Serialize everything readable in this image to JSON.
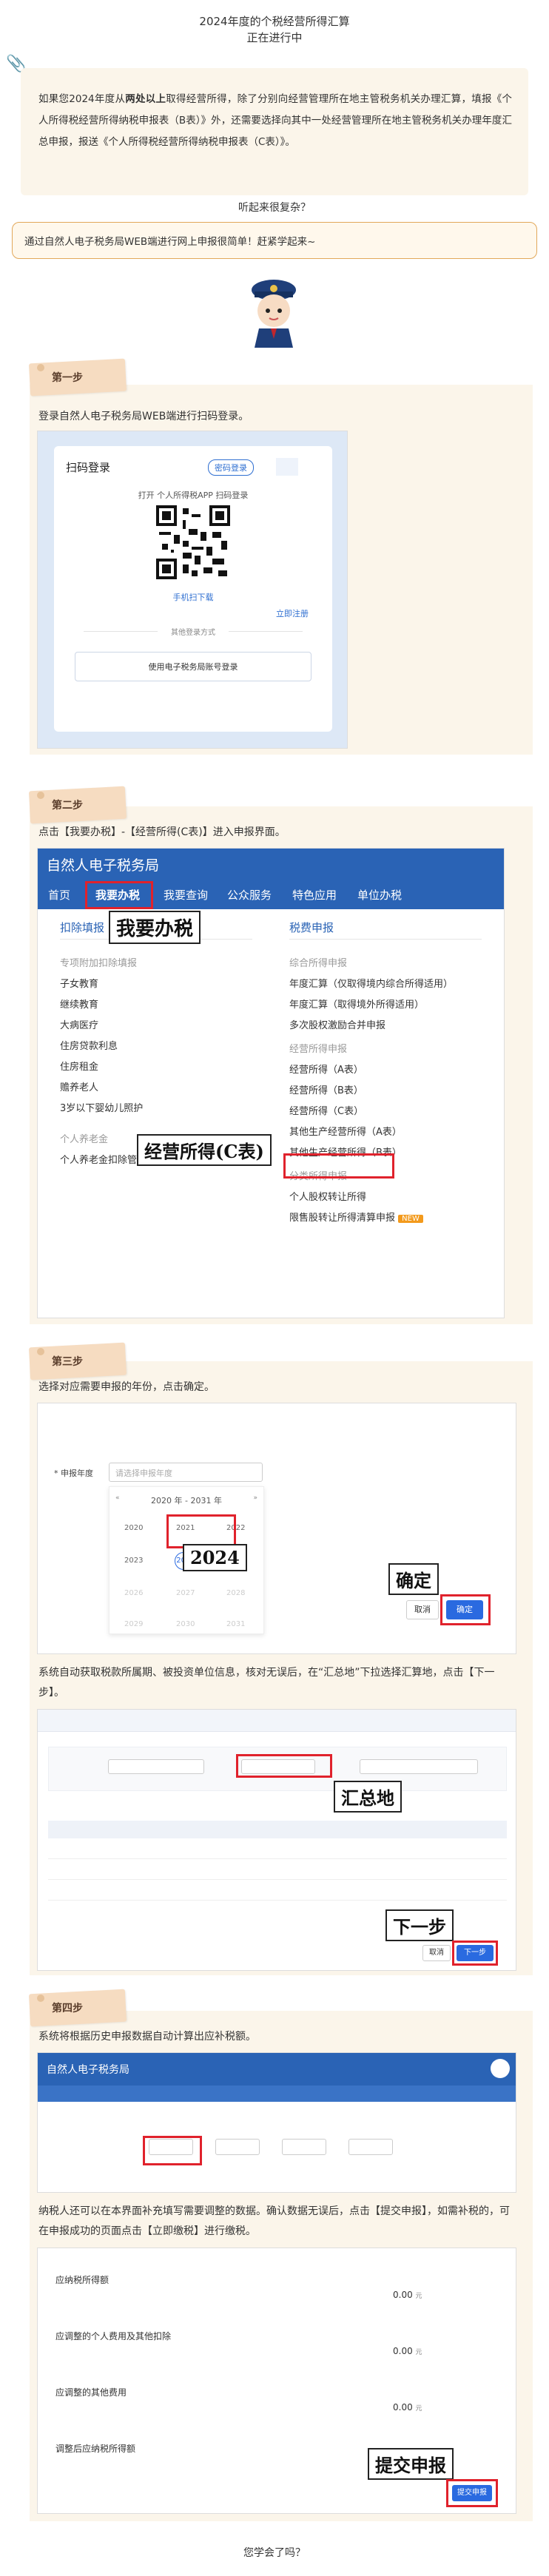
{
  "header": {
    "title": "2024年度的个税经营所得汇算",
    "subtitle": "正在进行中"
  },
  "intro": {
    "p1_a": "如果您2024年度从",
    "p1_bold": "两处以上",
    "p1_b": "取得经营所得，除了分别向经营管理所在地主管税务机关办理汇算，填报《个人所得税经营所得纳税申报表（B表）》外，还需要选择向其中一处经营管理所在地主管税务机关办理年度汇总申报，报送《个人所得税经营所得纳税申报表（C表）》。"
  },
  "question": "听起来很复杂？",
  "bubble": "通过自然人电子税务局WEB端进行网上申报很简单！赶紧学起来~",
  "steps": {
    "s1": {
      "label": "第一步",
      "text": "登录自然人电子税务局WEB端进行扫码登录。",
      "login": {
        "title": "扫码登录",
        "pwd_tab": "密码登录",
        "hint": "打开 个人所得税APP 扫码登录",
        "manual": "手机扫下载",
        "register": "立即注册",
        "other": "其他登录方式",
        "cert_btn": "使用电子税务局账号登录"
      }
    },
    "s2": {
      "label": "第二步",
      "text": "点击【我要办税】-【经营所得(C表)】进入申报界面。",
      "site_title": "自然人电子税务局",
      "nav": [
        "首页",
        "我要办税",
        "我要查询",
        "公众服务",
        "特色应用",
        "单位办税"
      ],
      "left_head": "扣除填报",
      "right_head": "税费申报",
      "left_group": "专项附加扣除填报",
      "left_items": [
        "子女教育",
        "继续教育",
        "大病医疗",
        "住房贷款利息",
        "住房租金",
        "赡养老人",
        "3岁以下婴幼儿照护"
      ],
      "left_group2": "个人养老金",
      "left_items2": [
        "个人养老金扣除管理"
      ],
      "right_group1": "综合所得申报",
      "right_items1": [
        "年度汇算（仅取得境内综合所得适用）",
        "年度汇算（取得境外所得适用）",
        "多次股权激励合并申报"
      ],
      "right_group2": "经营所得申报",
      "right_items2": [
        "经营所得（A表）",
        "经营所得（B表）",
        "经营所得（C表）",
        "其他生产经营所得（A表）",
        "其他生产经营所得（B表）"
      ],
      "right_group3": "分类所得申报",
      "right_items3": [
        "个人股权转让所得",
        "限售股转让所得清算申报"
      ],
      "new_badge": "NEW",
      "callout1": "我要办税",
      "callout2": "经营所得(C表)"
    },
    "s3": {
      "label": "第三步",
      "text": "选择对应需要申报的年份，点击确定。",
      "field_label": "* 申报年度",
      "field_placeholder": "请选择申报年度",
      "range": "2020 年 - 2031 年",
      "years": [
        "2020",
        "2021",
        "2022",
        "2023",
        "2024",
        "2025",
        "2026",
        "2027",
        "2028",
        "2029",
        "2030",
        "2031"
      ],
      "cancel": "取消",
      "ok": "确定",
      "callout_year": "2024",
      "callout_ok": "确定",
      "text2": "系统自动获取税款所属期、被投资单位信息，核对无误后，在“汇总地”下拉选择汇算地，点击【下一步】。",
      "callout_hz": "汇总地",
      "callout_next": "下一步",
      "next_btn": "下一步",
      "prev_btn": "取消"
    },
    "s4": {
      "label": "第四步",
      "text": "系统将根据历史申报数据自动计算出应补税额。",
      "text2": "纳税人还可以在本界面补充填写需要调整的数据。确认数据无误后，点击【提交申报】，如需补税的，可在申报成功的页面点击【立即缴税】进行缴税。",
      "items": [
        "应纳税所得额",
        "应调整的个人费用及其他扣除",
        "应调整的其他费用",
        "调整后应纳税所得额"
      ],
      "amount": "0.00",
      "unit": "元",
      "callout_submit": "提交申报",
      "submit_btn": "提交申报"
    }
  },
  "footer": "您学会了吗？",
  "colors": {
    "accent_orange": "#e2a85a",
    "panel_beige": "#fbf5ea",
    "nav_blue": "#2a63b5",
    "highlight_red": "#e0222c"
  }
}
